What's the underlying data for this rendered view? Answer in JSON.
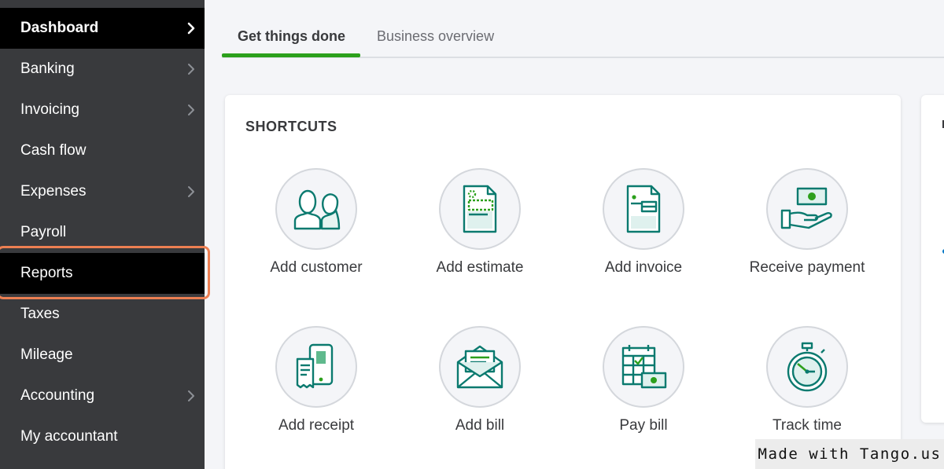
{
  "sidebar": {
    "items": [
      {
        "label": "Dashboard",
        "chevron": true,
        "state": "active"
      },
      {
        "label": "Banking",
        "chevron": true
      },
      {
        "label": "Invoicing",
        "chevron": true
      },
      {
        "label": "Cash flow",
        "chevron": false
      },
      {
        "label": "Expenses",
        "chevron": true
      },
      {
        "label": "Payroll",
        "chevron": false
      },
      {
        "label": "Reports",
        "chevron": false,
        "state": "highlighted"
      },
      {
        "label": "Taxes",
        "chevron": false
      },
      {
        "label": "Mileage",
        "chevron": false
      },
      {
        "label": "Accounting",
        "chevron": true
      },
      {
        "label": "My accountant",
        "chevron": false
      }
    ]
  },
  "tabs": [
    {
      "label": "Get things done",
      "active": true
    },
    {
      "label": "Business overview",
      "active": false
    }
  ],
  "shortcuts": {
    "title": "SHORTCUTS",
    "items": [
      {
        "label": "Add customer",
        "icon": "customer-icon"
      },
      {
        "label": "Add estimate",
        "icon": "estimate-icon"
      },
      {
        "label": "Add invoice",
        "icon": "invoice-icon"
      },
      {
        "label": "Receive payment",
        "icon": "payment-icon"
      },
      {
        "label": "Add receipt",
        "icon": "receipt-icon"
      },
      {
        "label": "Add bill",
        "icon": "bill-icon"
      },
      {
        "label": "Pay bill",
        "icon": "pay-bill-icon"
      },
      {
        "label": "Track time",
        "icon": "stopwatch-icon"
      }
    ]
  },
  "watermark": "Made with Tango.us",
  "colors": {
    "sidebar_bg": "#393a3d",
    "active_bg": "#000000",
    "accent_green": "#2ca01c",
    "icon_teal": "#0b7a6f",
    "highlight_orange": "#ec7f52"
  }
}
